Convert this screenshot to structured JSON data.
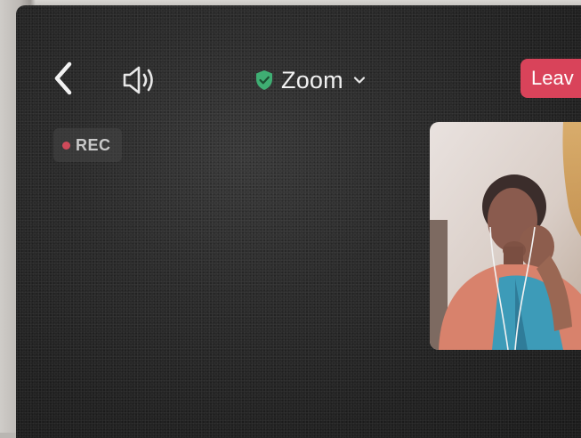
{
  "window": {
    "title": "Zoom"
  },
  "toolbar": {
    "back_icon": "chevron-left-icon",
    "speaker_icon": "speaker-icon",
    "shield_icon": "shield-check-icon",
    "dropdown_icon": "chevron-down-icon",
    "leave_label": "Leav"
  },
  "recording": {
    "label": "REC",
    "dot_color": "#d04a5a"
  },
  "self_view": {
    "description_icon": "participant-video"
  },
  "colors": {
    "background": "#262626",
    "leave_button": "#d9435a",
    "shield": "#3fae73",
    "text": "#f1f1f1"
  }
}
